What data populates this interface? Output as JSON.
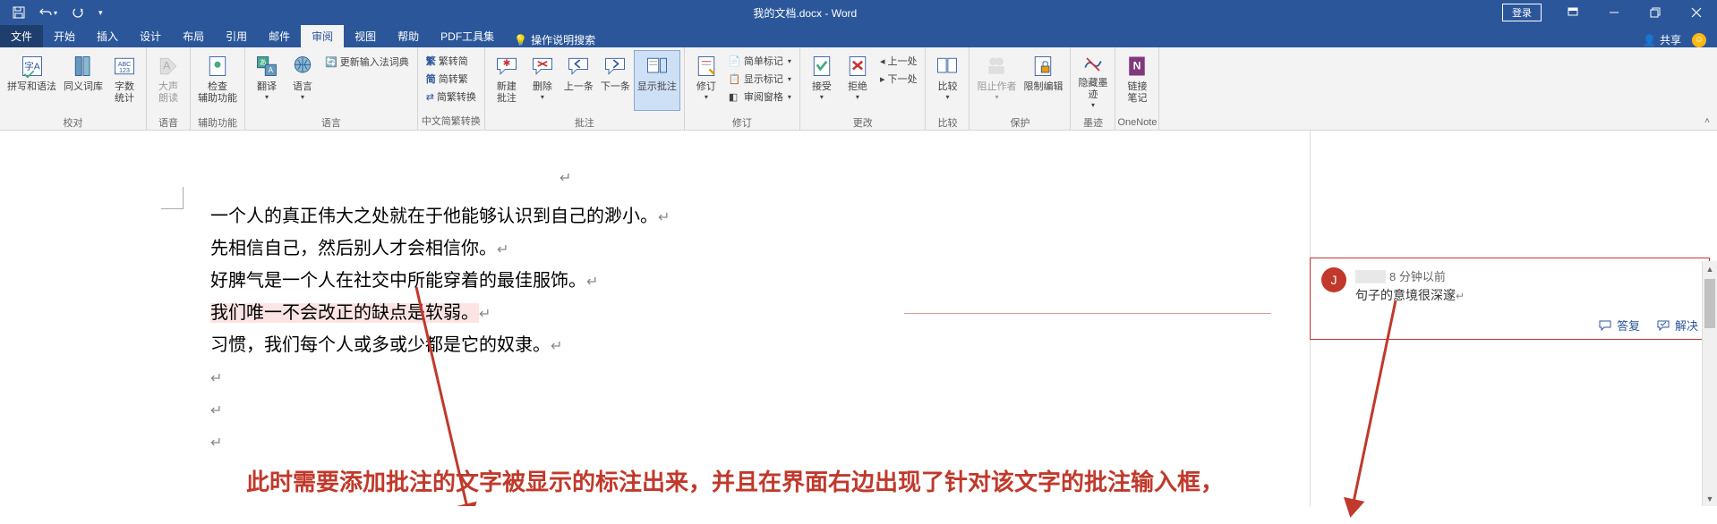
{
  "titlebar": {
    "title": "我的文档.docx - Word",
    "login": "登录"
  },
  "tabs": {
    "file": "文件",
    "home": "开始",
    "insert": "插入",
    "design": "设计",
    "layout": "布局",
    "references": "引用",
    "mail": "邮件",
    "review": "审阅",
    "view": "视图",
    "help": "帮助",
    "pdf": "PDF工具集",
    "tellme": "操作说明搜索",
    "share": "共享"
  },
  "ribbon": {
    "proofing": {
      "spelling": "拼写和语法",
      "thesaurus": "同义词库",
      "wordcount": "字数\n统计",
      "label": "校对"
    },
    "speech": {
      "readaloud": "大声\n朗读",
      "label": "语音"
    },
    "accessibility": {
      "check": "检查\n辅助功能",
      "label": "辅助功能"
    },
    "language": {
      "translate": "翻译",
      "language": "语言",
      "update": "更新输入法词典",
      "label": "语言"
    },
    "chinese": {
      "simpl": "繁转简",
      "trad": "简转繁",
      "convert": "简繁转换",
      "label": "中文简繁转换"
    },
    "comments": {
      "new": "新建\n批注",
      "delete": "删除",
      "prev": "上一条",
      "next": "下一条",
      "show": "显示批注",
      "label": "批注"
    },
    "tracking": {
      "track": "修订",
      "simple": "简单标记",
      "showmarkup": "显示标记",
      "pane": "审阅窗格",
      "label": "修订"
    },
    "changes": {
      "accept": "接受",
      "reject": "拒绝",
      "prev": "上一处",
      "next": "下一处",
      "label": "更改"
    },
    "compare": {
      "compare": "比较",
      "label": "比较"
    },
    "protect": {
      "block": "阻止作者",
      "restrict": "限制编辑",
      "label": "保护"
    },
    "ink": {
      "hide": "隐藏墨\n迹",
      "label": "墨迹"
    },
    "onenote": {
      "link": "链接\n笔记",
      "label": "OneNote"
    }
  },
  "document": {
    "line1": "一个人的真正伟大之处就在于他能够认识到自己的渺小。",
    "line2": "先相信自己，然后别人才会相信你。",
    "line3": "好脾气是一个人在社交中所能穿着的最佳服饰。",
    "line4": "我们唯一不会改正的缺点是软弱。",
    "line5": "习惯，我们每个人或多或少都是它的奴隶。"
  },
  "comment": {
    "avatar": "J",
    "time": "8 分钟以前",
    "body": "句子的意境很深邃",
    "reply": "答复",
    "resolve": "解决"
  },
  "annotation": "此时需要添加批注的文字被显示的标注出来，并且在界面右边出现了针对该文字的批注输入框，"
}
